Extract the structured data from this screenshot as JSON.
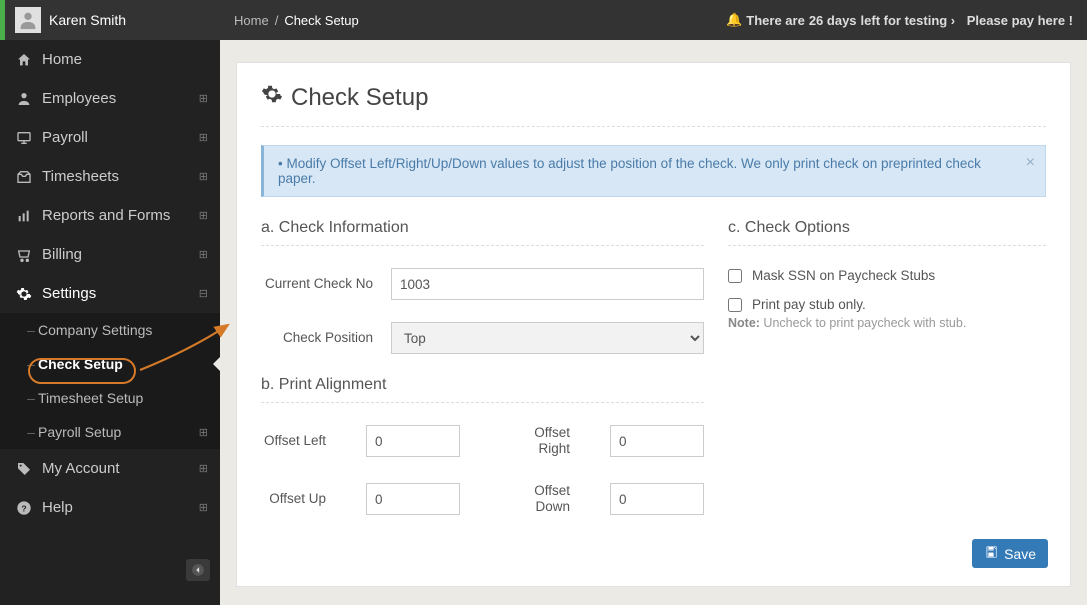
{
  "user": {
    "name": "Karen Smith"
  },
  "nav": {
    "home": "Home",
    "employees": "Employees",
    "payroll": "Payroll",
    "timesheets": "Timesheets",
    "reports": "Reports and Forms",
    "billing": "Billing",
    "settings": "Settings",
    "settings_sub": {
      "company": "Company Settings",
      "check": "Check Setup",
      "timesheet": "Timesheet Setup",
      "payroll": "Payroll Setup"
    },
    "my_account": "My Account",
    "help": "Help"
  },
  "breadcrumb": {
    "home": "Home",
    "sep": "/",
    "current": "Check Setup"
  },
  "top_alert": {
    "pre": "There are ",
    "count": "26 days",
    "post": " left for testing ›",
    "pay": "Please pay here !"
  },
  "page_title": {
    "a": "Check",
    "b": "Setup"
  },
  "info_alert": "Modify Offset Left/Right/Up/Down values to adjust the position of the check. We only print check on preprinted check paper.",
  "sections": {
    "a_title": "a. Check Information",
    "b_title": "b. Print Alignment",
    "c_title": "c. Check Options"
  },
  "check_info": {
    "current_no_label": "Current Check No",
    "current_no_value": "1003",
    "position_label": "Check Position",
    "position_value": "Top"
  },
  "alignment": {
    "offset_left_label": "Offset Left",
    "offset_left_value": "0",
    "offset_right_label": "Offset Right",
    "offset_right_value": "0",
    "offset_up_label": "Offset Up",
    "offset_up_value": "0",
    "offset_down_label": "Offset Down",
    "offset_down_value": "0"
  },
  "options": {
    "mask_ssn": "Mask SSN on Paycheck Stubs",
    "print_stub": "Print pay stub only.",
    "note_strong": "Note:",
    "note_text": " Uncheck to print paycheck with stub."
  },
  "buttons": {
    "save": "Save"
  }
}
